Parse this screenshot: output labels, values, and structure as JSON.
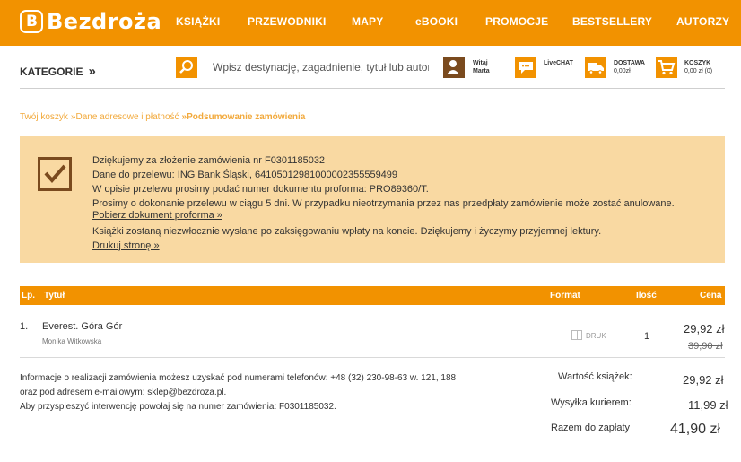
{
  "header": {
    "logo_letter": "B",
    "logo_text": "Bezdroża",
    "nav": [
      "KSIĄŻKI",
      "PRZEWODNIKI",
      "MAPY",
      "eBOOKI",
      "PROMOCJE",
      "BESTSELLERY",
      "AUTORZY"
    ]
  },
  "subbar": {
    "categories": "KATEGORIE",
    "search_placeholder": "Wpisz destynację, zagadnienie, tytuł lub autora",
    "user_greeting": "Witaj",
    "user_name": "Marta",
    "livechat": "LiveCHAT",
    "delivery_label": "DOSTAWA",
    "delivery_value": "0,00zł",
    "cart_label": "KOSZYK",
    "cart_value": "0,00 zł (0)"
  },
  "breadcrumb": {
    "step1": "Twój koszyk",
    "step2": "»Dane adresowe i płatność",
    "step3": "»Podsumowanie zamówienia"
  },
  "confirmation": {
    "line1": "Dziękujemy za złożenie zamówienia nr F0301185032",
    "line2": "Dane do przelewu: ING Bank Śląski, 64105012981000002355559499",
    "line3": "W opisie przelewu prosimy podać numer dokumentu proforma: PRO89360/T.",
    "line4": "Prosimy o dokonanie przelewu w ciągu 5 dni. W przypadku nieotrzymania przez nas przedpłaty zamówienie może zostać anulowane.",
    "proforma_link": "Pobierz dokument proforma »",
    "line5": "Książki zostaną niezwłocznie wysłane po zaksięgowaniu wpłaty na koncie. Dziękujemy i życzymy przyjemnej lektury.",
    "print_link": "Drukuj stronę »"
  },
  "table": {
    "headers": {
      "lp": "Lp.",
      "title": "Tytuł",
      "format": "Format",
      "qty": "Ilość",
      "price": "Cena"
    },
    "rows": [
      {
        "lp": "1.",
        "title": "Everest. Góra Gór",
        "author": "Monika Witkowska",
        "format": "DRUK",
        "qty": "1",
        "price": "29,92 zł",
        "old_price": "39,90 zł"
      }
    ]
  },
  "info": {
    "line1": "Informacje o realizacji zamówienia możesz uzyskać pod numerami telefonów: +48 (32) 230-98-63 w. 121, 188",
    "line2": "oraz pod adresem e-mailowym: sklep@bezdroza.pl.",
    "line3": "Aby przyspieszyć interwencję powołaj się na numer zamówienia: F0301185032."
  },
  "summary": {
    "books_label": "Wartość książek:",
    "books_value": "29,92 zł",
    "shipping_label": "Wysyłka kurierem:",
    "shipping_value": "11,99 zł",
    "total_label": "Razem do zapłaty",
    "total_value": "41,90 zł"
  },
  "colors": {
    "brand_orange": "#f29200",
    "confirm_bg": "#f9d9a2",
    "dark_brown": "#7a4a1e",
    "breadcrumb": "#f2a93b"
  }
}
